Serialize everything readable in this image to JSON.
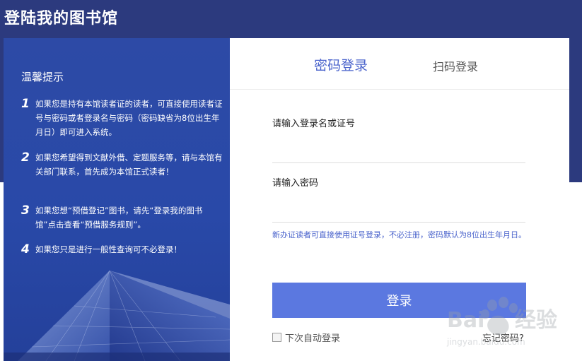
{
  "page": {
    "title": "登陆我的图书馆"
  },
  "tips": {
    "title": "温馨提示",
    "items": [
      {
        "num": "1",
        "text": "如果您是持有本馆读者证的读者，可直接使用读者证号与密码或者登录名与密码（密码缺省为8位出生年月日）即可进入系统。"
      },
      {
        "num": "2",
        "text": "如果您希望得到文献外借、定题服务等，请与本馆有关部门联系，首先成为本馆正式读者！"
      },
      {
        "num": "3",
        "text": "如果您想“预借登记”图书，请先“登录我的图书馆”点击查看“预借服务规则”。"
      },
      {
        "num": "4",
        "text": "如果您只是进行一般性查询可不必登录！"
      }
    ]
  },
  "login": {
    "tabs": [
      {
        "label": "密码登录",
        "active": true
      },
      {
        "label": "扫码登录",
        "active": false
      }
    ],
    "username_label": "请输入登录名或证号",
    "username_value": "",
    "password_label": "请输入密码",
    "password_value": "",
    "hint": "新办证读者可直接使用证号登录，不必注册，密码默认为8位出生年月日。",
    "submit_label": "登录",
    "remember_label": "下次自动登录",
    "remember_checked": false,
    "forgot_label": "忘记密码?"
  },
  "colors": {
    "band": "#2c3a7e",
    "panel": "#2949a8",
    "accent": "#4b64cc",
    "button": "#5b78e0"
  }
}
